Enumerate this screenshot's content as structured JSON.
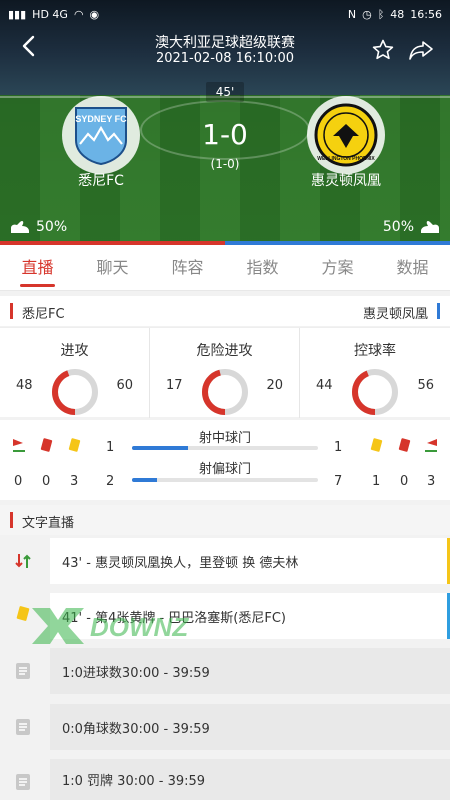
{
  "status_bar": {
    "left_text": "HD 4G",
    "time": "16:56",
    "battery": "48"
  },
  "header": {
    "league": "澳大利亚足球超级联赛",
    "datetime": "2021-02-08 16:10:00",
    "minute": "45'"
  },
  "match": {
    "home": {
      "name": "悉尼FC",
      "logo_text": "SYDNEY FC"
    },
    "away": {
      "name": "惠灵顿凤凰",
      "logo_text": "WELLINGTON PHOENIX"
    },
    "score": "1-0",
    "half_score": "(1-0)",
    "home_possession_label": "50%",
    "away_possession_label": "50%"
  },
  "tabs": [
    {
      "label": "直播",
      "active": true
    },
    {
      "label": "聊天",
      "active": false
    },
    {
      "label": "阵容",
      "active": false
    },
    {
      "label": "指数",
      "active": false
    },
    {
      "label": "方案",
      "active": false
    },
    {
      "label": "数据",
      "active": false
    }
  ],
  "teams_row": {
    "home": "悉尼FC",
    "away": "惠灵顿凤凰"
  },
  "stats": [
    {
      "label": "进攻",
      "home": "48",
      "away": "60",
      "home_value": 48,
      "away_value": 60
    },
    {
      "label": "危险进攻",
      "home": "17",
      "away": "20",
      "home_value": 17,
      "away_value": 20
    },
    {
      "label": "控球率",
      "home": "44",
      "away": "56",
      "home_value": 44,
      "away_value": 56
    }
  ],
  "shots": {
    "on_target": {
      "label": "射中球门",
      "home": "1",
      "away": "1",
      "home_value": 1,
      "away_value": 1
    },
    "off_target": {
      "label": "射偏球门",
      "home": "2",
      "away": "7",
      "home_value": 2,
      "away_value": 7
    },
    "home_counts": {
      "corners": "0",
      "red": "0",
      "yellow": "3"
    },
    "away_counts": {
      "yellow": "1",
      "red": "0",
      "corners": "3"
    }
  },
  "live_text": {
    "title": "文字直播",
    "items": [
      {
        "text": "43' - 惠灵顿凤凰换人，里登顿 换 德夫林",
        "type": "sub",
        "side_color": "#f5c518"
      },
      {
        "text": "41' - 第4张黄牌 - 巴巴洛塞斯(悉尼FC)",
        "type": "yellow",
        "side_color": "#2f9ee0"
      },
      {
        "text": "1:0进球数30:00 - 39:59",
        "type": "doc"
      },
      {
        "text": "0:0角球数30:00 - 39:59",
        "type": "doc"
      },
      {
        "text": "1:0 罚牌 30:00 - 39:59",
        "type": "doc"
      }
    ]
  },
  "colors": {
    "accent": "#d6352b",
    "away": "#2f7ad6",
    "ring_grey": "#d8d8d8"
  },
  "watermark": "DOWNZ"
}
